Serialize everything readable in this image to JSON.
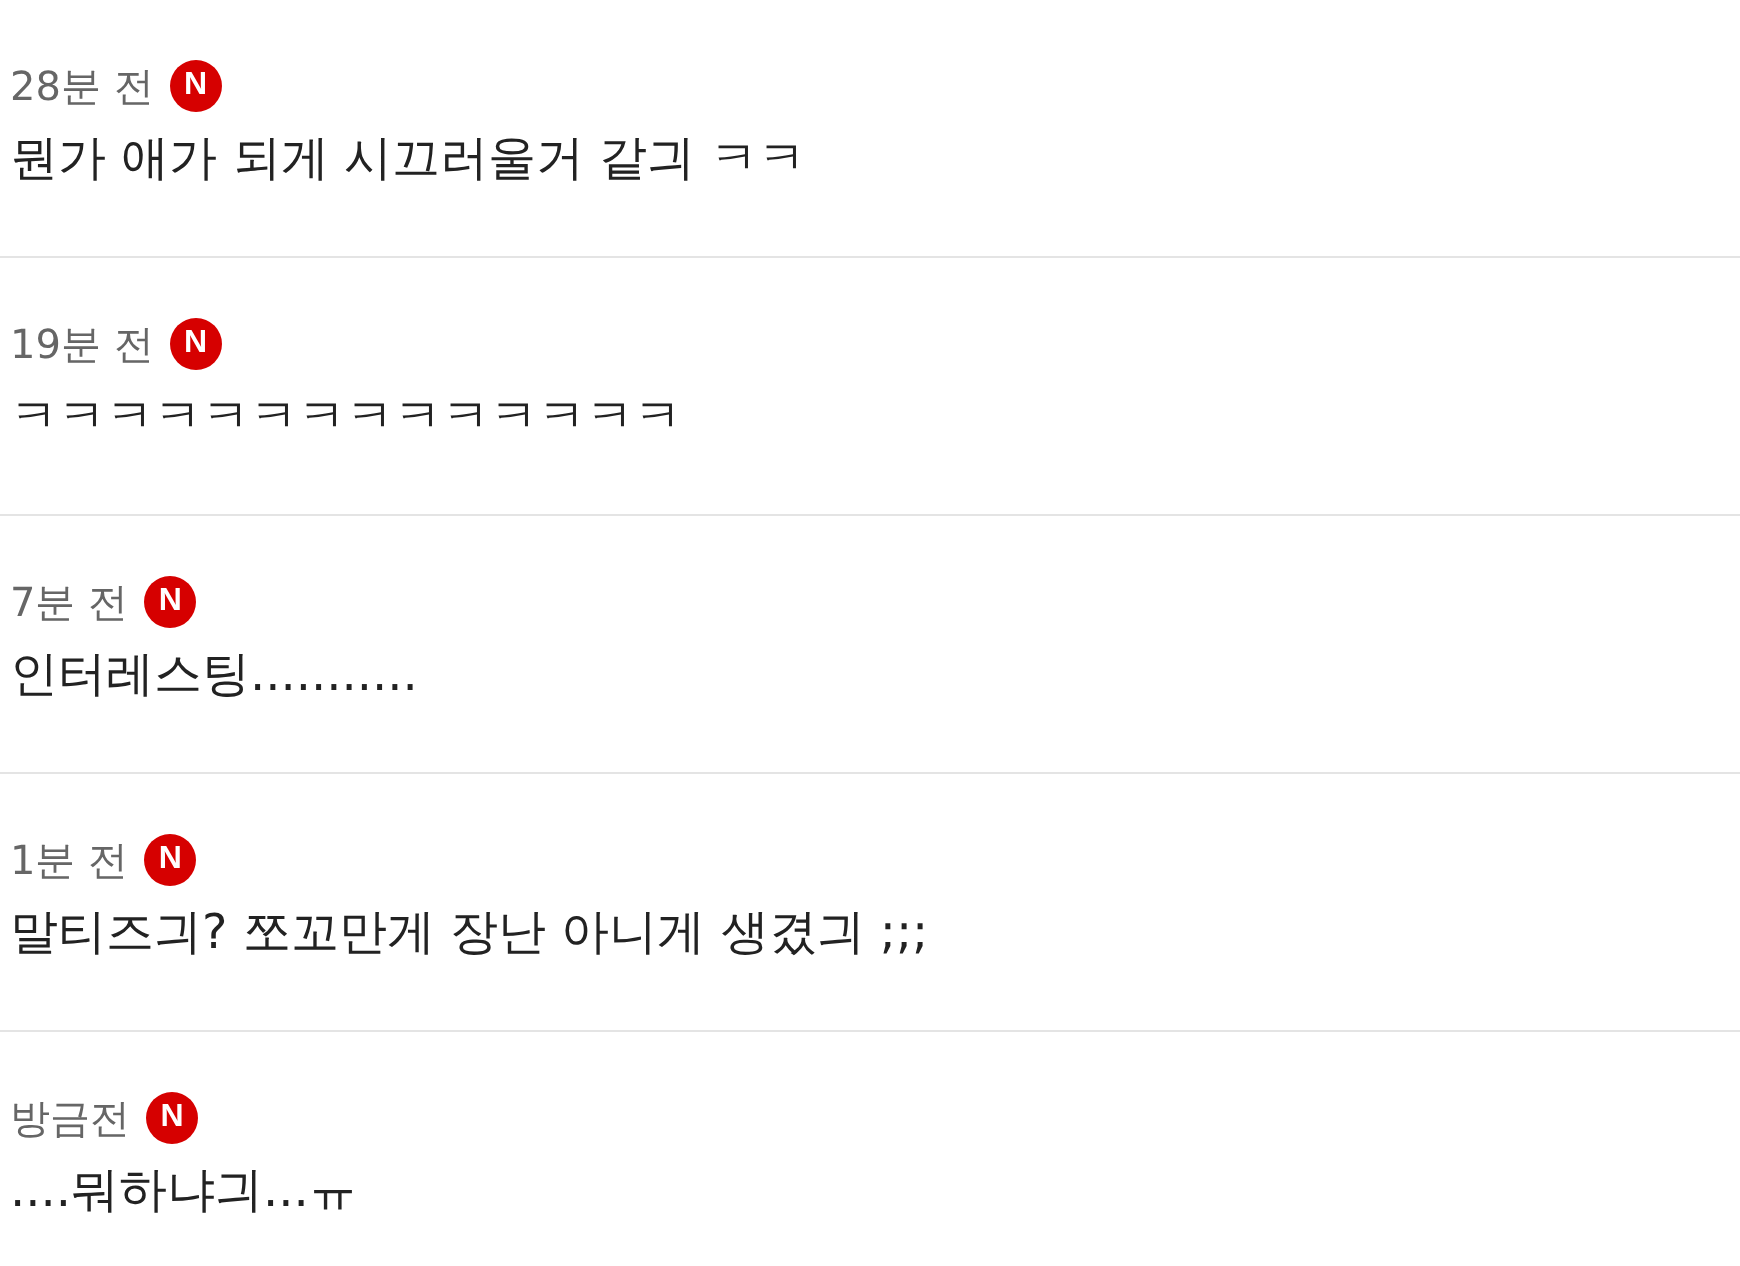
{
  "comments": [
    {
      "time": "28분 전",
      "badge": "N",
      "text": "뭔가 애가 되게 시끄러울거 같긔 ㅋㅋ"
    },
    {
      "time": "19분 전",
      "badge": "N",
      "text": "ㅋㅋㅋㅋㅋㅋㅋㅋㅋㅋㅋㅋㅋㅋ"
    },
    {
      "time": "7분 전",
      "badge": "N",
      "text": "인터레스팅..........."
    },
    {
      "time": "1분 전",
      "badge": "N",
      "text": "말티즈긔? 쪼꼬만게 장난 아니게 생겼긔 ;;;"
    },
    {
      "time": "방금전",
      "badge": "N",
      "text": "....뭐하냐긔...ㅠ"
    }
  ]
}
